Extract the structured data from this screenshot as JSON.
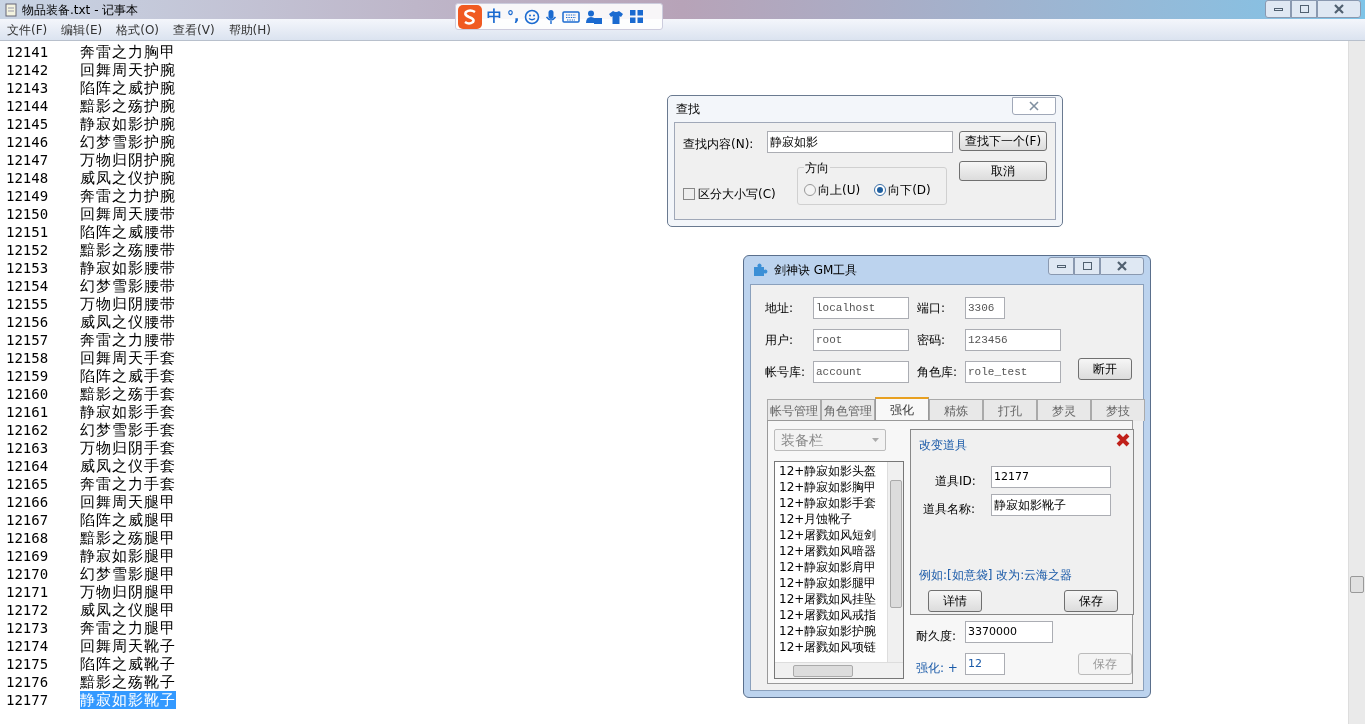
{
  "window": {
    "title": "物品装备.txt - 记事本"
  },
  "ime_bar": {
    "mode": "中",
    "punct": "°,"
  },
  "menu": [
    "文件(F)",
    "编辑(E)",
    "格式(O)",
    "查看(V)",
    "帮助(H)"
  ],
  "lines": [
    {
      "number": "12141",
      "text": "奔雷之力胸甲",
      "selected": false
    },
    {
      "number": "12142",
      "text": "回舞周天护腕",
      "selected": false
    },
    {
      "number": "12143",
      "text": "陷阵之威护腕",
      "selected": false
    },
    {
      "number": "12144",
      "text": "黯影之殇护腕",
      "selected": false
    },
    {
      "number": "12145",
      "text": "静寂如影护腕",
      "selected": false
    },
    {
      "number": "12146",
      "text": "幻梦雪影护腕",
      "selected": false
    },
    {
      "number": "12147",
      "text": "万物归阴护腕",
      "selected": false
    },
    {
      "number": "12148",
      "text": "威凤之仪护腕",
      "selected": false
    },
    {
      "number": "12149",
      "text": "奔雷之力护腕",
      "selected": false
    },
    {
      "number": "12150",
      "text": "回舞周天腰带",
      "selected": false
    },
    {
      "number": "12151",
      "text": "陷阵之威腰带",
      "selected": false
    },
    {
      "number": "12152",
      "text": "黯影之殇腰带",
      "selected": false
    },
    {
      "number": "12153",
      "text": "静寂如影腰带",
      "selected": false
    },
    {
      "number": "12154",
      "text": "幻梦雪影腰带",
      "selected": false
    },
    {
      "number": "12155",
      "text": "万物归阴腰带",
      "selected": false
    },
    {
      "number": "12156",
      "text": "威凤之仪腰带",
      "selected": false
    },
    {
      "number": "12157",
      "text": "奔雷之力腰带",
      "selected": false
    },
    {
      "number": "12158",
      "text": "回舞周天手套",
      "selected": false
    },
    {
      "number": "12159",
      "text": "陷阵之威手套",
      "selected": false
    },
    {
      "number": "12160",
      "text": "黯影之殇手套",
      "selected": false
    },
    {
      "number": "12161",
      "text": "静寂如影手套",
      "selected": false
    },
    {
      "number": "12162",
      "text": "幻梦雪影手套",
      "selected": false
    },
    {
      "number": "12163",
      "text": "万物归阴手套",
      "selected": false
    },
    {
      "number": "12164",
      "text": "威凤之仪手套",
      "selected": false
    },
    {
      "number": "12165",
      "text": "奔雷之力手套",
      "selected": false
    },
    {
      "number": "12166",
      "text": "回舞周天腿甲",
      "selected": false
    },
    {
      "number": "12167",
      "text": "陷阵之威腿甲",
      "selected": false
    },
    {
      "number": "12168",
      "text": "黯影之殇腿甲",
      "selected": false
    },
    {
      "number": "12169",
      "text": "静寂如影腿甲",
      "selected": false
    },
    {
      "number": "12170",
      "text": "幻梦雪影腿甲",
      "selected": false
    },
    {
      "number": "12171",
      "text": "万物归阴腿甲",
      "selected": false
    },
    {
      "number": "12172",
      "text": "威凤之仪腿甲",
      "selected": false
    },
    {
      "number": "12173",
      "text": "奔雷之力腿甲",
      "selected": false
    },
    {
      "number": "12174",
      "text": "回舞周天靴子",
      "selected": false
    },
    {
      "number": "12175",
      "text": "陷阵之威靴子",
      "selected": false
    },
    {
      "number": "12176",
      "text": "黯影之殇靴子",
      "selected": false
    },
    {
      "number": "12177",
      "text": "静寂如影靴子",
      "selected": true
    }
  ],
  "find_dialog": {
    "title": "查找",
    "find_label": "查找内容(N):",
    "find_value": "静寂如影",
    "find_next": "查找下一个(F)",
    "cancel": "取消",
    "match_case": {
      "label": "区分大小写(C)",
      "checked": false
    },
    "direction": {
      "label": "方向",
      "options": [
        {
          "label": "向上(U)",
          "selected": false
        },
        {
          "label": "向下(D)",
          "selected": true
        }
      ]
    }
  },
  "gm_tool": {
    "title": "剑神诀 GM工具",
    "fields": [
      {
        "label": "地址:",
        "value": "localhost"
      },
      {
        "label": "端口:",
        "value": "3306"
      },
      {
        "label": "用户:",
        "value": "root"
      },
      {
        "label": "密码:",
        "value": "123456"
      },
      {
        "label": "帐号库:",
        "value": "account"
      },
      {
        "label": "角色库:",
        "value": "role_test"
      }
    ],
    "disconnect": "断开",
    "tabs": [
      {
        "label": "帐号管理",
        "selected": false
      },
      {
        "label": "角色管理",
        "selected": false
      },
      {
        "label": "强化",
        "selected": true
      },
      {
        "label": "精炼",
        "selected": false
      },
      {
        "label": "打孔",
        "selected": false
      },
      {
        "label": "梦灵",
        "selected": false
      },
      {
        "label": "梦技",
        "selected": false
      }
    ],
    "slot_dropdown": "装备栏",
    "items": [
      "12+静寂如影头盔",
      "12+静寂如影胸甲",
      "12+静寂如影手套",
      "12+月蚀靴子",
      "12+屠戮如风短剑",
      "12+屠戮如风暗器",
      "12+静寂如影肩甲",
      "12+静寂如影腿甲",
      "12+屠戮如风挂坠",
      "12+屠戮如风戒指",
      "12+静寂如影护腕",
      "12+屠戮如风项链"
    ],
    "change_item": {
      "title": "改变道具",
      "id_label": "道具ID:",
      "id_value": "12177",
      "name_label": "道具名称:",
      "name_value": "静寂如影靴子",
      "example": "例如:[如意袋] 改为:云海之器",
      "details": "详情",
      "save": "保存"
    },
    "durability": {
      "label": "耐久度:",
      "value": "3370000"
    },
    "enhance": {
      "label": "强化: +",
      "value": "12"
    },
    "save": "保存"
  }
}
